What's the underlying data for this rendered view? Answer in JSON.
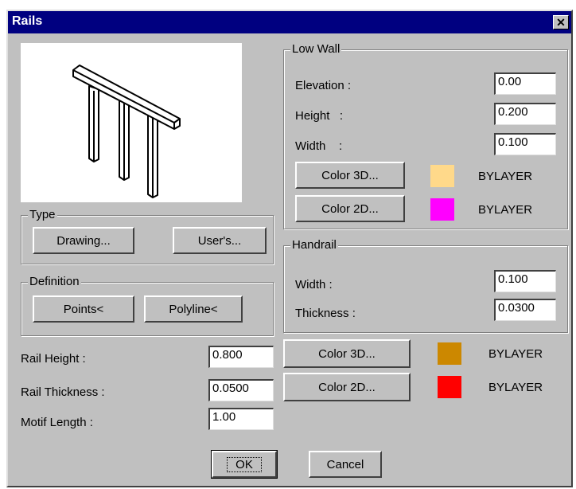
{
  "window": {
    "title": "Rails"
  },
  "colors": {
    "titlebar": "#000080",
    "face": "#c0c0c0",
    "lowwall_color3d": "#ffd98a",
    "lowwall_color2d": "#ff00ff",
    "handrail_color3d": "#cc8800",
    "handrail_color2d": "#ff0000"
  },
  "type_group": {
    "legend": "Type",
    "drawing_button": "Drawing...",
    "users_button": "User's..."
  },
  "definition_group": {
    "legend": "Definition",
    "points_button": "Points<",
    "polyline_button": "Polyline<"
  },
  "rail": {
    "height_label": "Rail Height :",
    "height_value": "0.800",
    "thickness_label": "Rail Thickness :",
    "thickness_value": "0.0500",
    "motif_label": "Motif Length :",
    "motif_value": "1.00"
  },
  "low_wall": {
    "legend": "Low Wall",
    "elevation_label": "Elevation :",
    "elevation_value": "0.00",
    "height_label": "Height   :",
    "height_value": "0.200",
    "width_label": "Width    :",
    "width_value": "0.100",
    "color3d_button": "Color 3D...",
    "color3d_layer": "BYLAYER",
    "color2d_button": "Color 2D...",
    "color2d_layer": "BYLAYER"
  },
  "handrail": {
    "legend": "Handrail",
    "width_label": "Width :",
    "width_value": "0.100",
    "thickness_label": "Thickness :",
    "thickness_value": "0.0300",
    "color3d_button": "Color 3D...",
    "color3d_layer": "BYLAYER",
    "color2d_button": "Color 2D...",
    "color2d_layer": "BYLAYER"
  },
  "actions": {
    "ok": "OK",
    "cancel": "Cancel"
  }
}
